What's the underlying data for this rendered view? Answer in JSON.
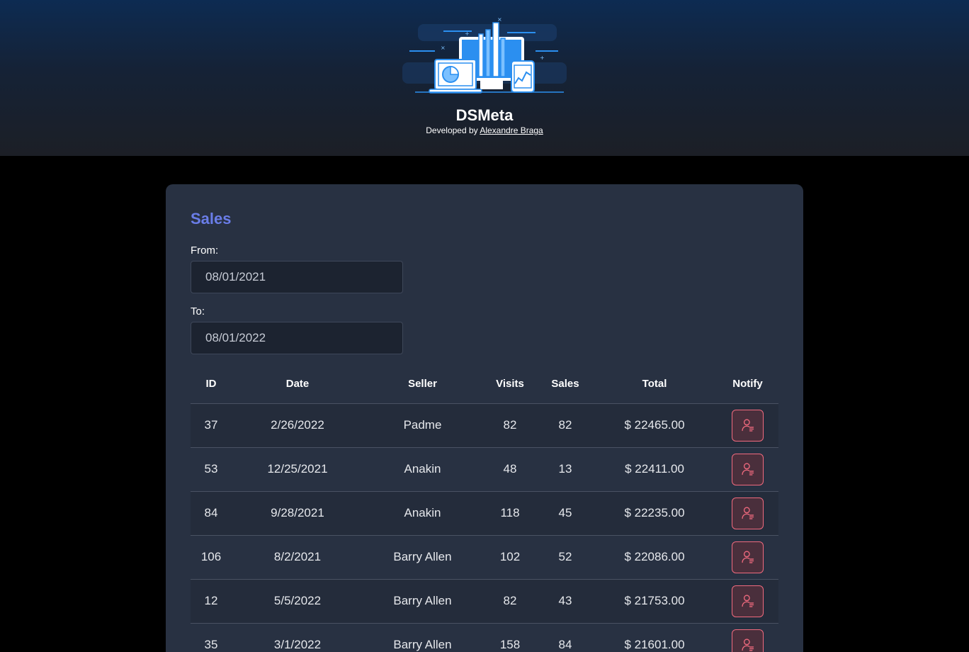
{
  "header": {
    "title": "DSMeta",
    "developed_by": "Developed by",
    "author": "Alexandre Braga",
    "logo_icon": "dashboard-devices-illustration"
  },
  "sales": {
    "title": "Sales",
    "from_label": "From:",
    "from_value": "08/01/2021",
    "to_label": "To:",
    "to_value": "08/01/2022",
    "columns": [
      "ID",
      "Date",
      "Seller",
      "Visits",
      "Sales",
      "Total",
      "Notify"
    ],
    "rows": [
      {
        "id": "37",
        "date": "2/26/2022",
        "seller": "Padme",
        "visits": "82",
        "sales": "82",
        "total": "$ 22465.00"
      },
      {
        "id": "53",
        "date": "12/25/2021",
        "seller": "Anakin",
        "visits": "48",
        "sales": "13",
        "total": "$ 22411.00"
      },
      {
        "id": "84",
        "date": "9/28/2021",
        "seller": "Anakin",
        "visits": "118",
        "sales": "45",
        "total": "$ 22235.00"
      },
      {
        "id": "106",
        "date": "8/2/2021",
        "seller": "Barry Allen",
        "visits": "102",
        "sales": "52",
        "total": "$ 22086.00"
      },
      {
        "id": "12",
        "date": "5/5/2022",
        "seller": "Barry Allen",
        "visits": "82",
        "sales": "43",
        "total": "$ 21753.00"
      },
      {
        "id": "35",
        "date": "3/1/2022",
        "seller": "Barry Allen",
        "visits": "158",
        "sales": "84",
        "total": "$ 21601.00"
      }
    ],
    "notify_icon": "user-notify-icon"
  },
  "colors": {
    "accent": "#6a7de8",
    "notify": "#f06a7e",
    "card": "#283142",
    "background": "#000000"
  }
}
